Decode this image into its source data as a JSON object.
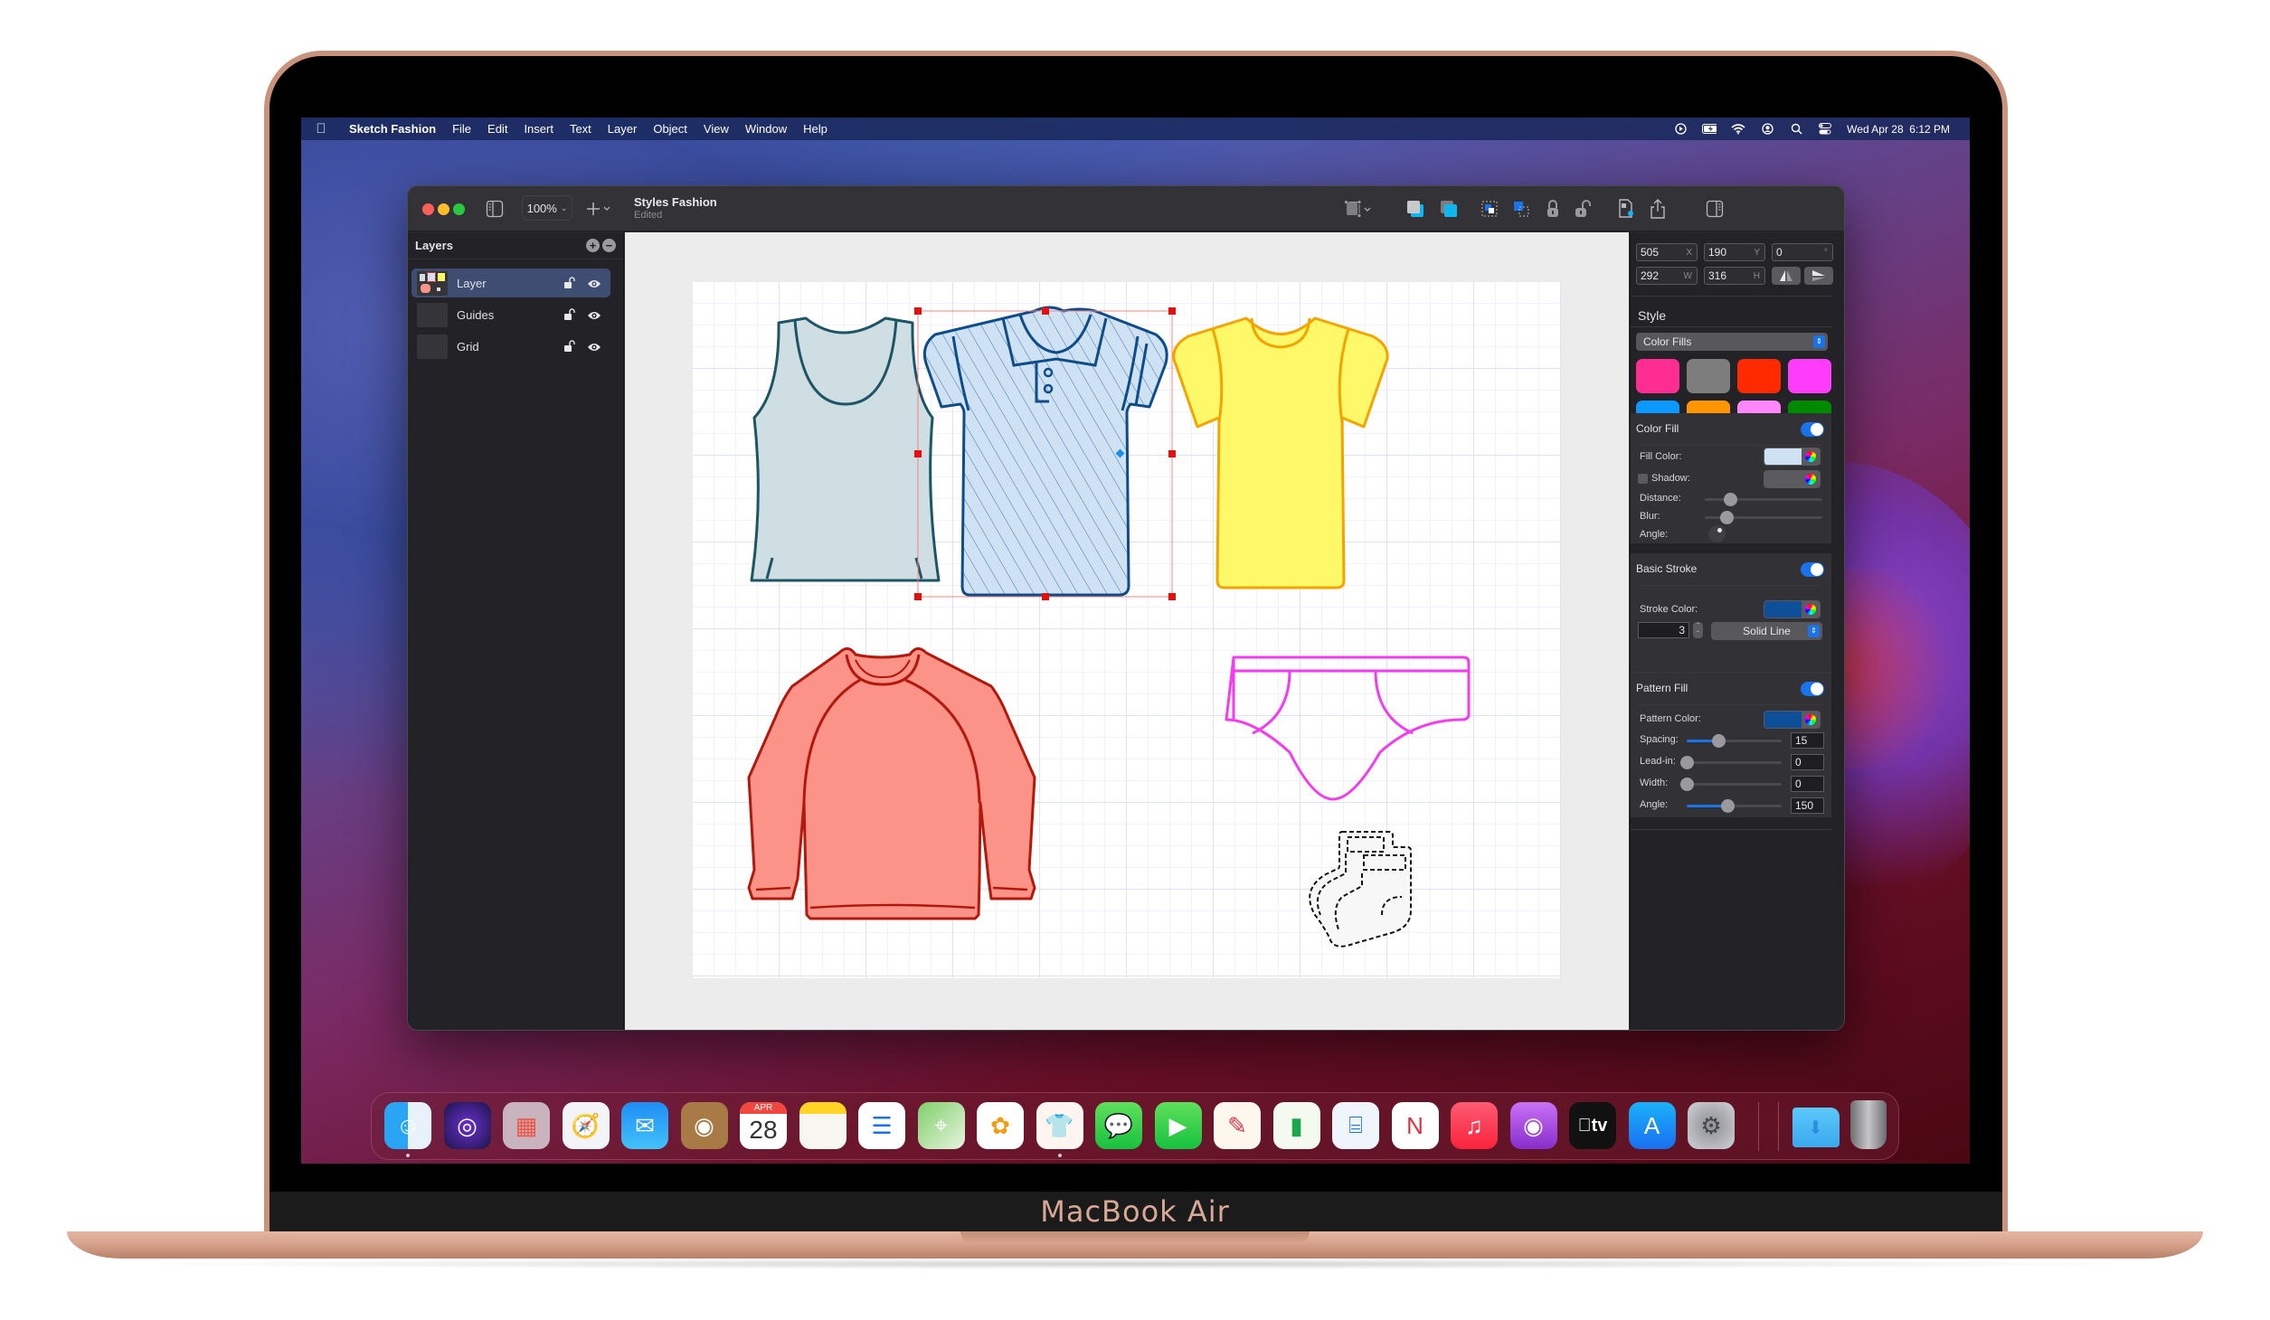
{
  "device": {
    "brand_label": "MacBook Air"
  },
  "menubar": {
    "app_name": "Sketch Fashion",
    "items": [
      "File",
      "Edit",
      "Insert",
      "Text",
      "Layer",
      "Object",
      "View",
      "Window",
      "Help"
    ],
    "status_icons": [
      "play-circle-icon",
      "battery-charging-icon",
      "wifi-icon",
      "user-icon",
      "search-icon",
      "control-center-icon"
    ],
    "clock": "Wed Apr 28  6:12 PM"
  },
  "window": {
    "zoom_level": "100%",
    "document_title": "Styles Fashion",
    "document_status": "Edited",
    "toolbar_icons": [
      "sidebar-toggle-icon",
      "insert-plus-icon",
      "artboard-icon",
      "bring-forward-icon",
      "send-backward-icon",
      "group-icon",
      "ungroup-icon",
      "lock-icon",
      "unlock-icon",
      "document-settings-icon",
      "share-icon",
      "inspector-toggle-icon"
    ]
  },
  "layers": {
    "title": "Layers",
    "add_label": "+",
    "remove_label": "−",
    "items": [
      {
        "name": "Layer",
        "selected": true,
        "locked": false,
        "visible": true
      },
      {
        "name": "Guides",
        "selected": false,
        "locked": false,
        "visible": true
      },
      {
        "name": "Grid",
        "selected": false,
        "locked": false,
        "visible": true
      }
    ]
  },
  "canvas": {
    "garments": [
      {
        "name": "tank-top",
        "fill": "#cfdee3",
        "stroke": "#1d5566"
      },
      {
        "name": "polo-shirt",
        "fill": "#cfe2f3",
        "stroke": "#0f4c8a",
        "pattern": "diagonal-lines",
        "selected": true
      },
      {
        "name": "t-shirt",
        "fill": "#fff96a",
        "stroke": "#f5a300"
      },
      {
        "name": "sweatshirt",
        "fill": "#fc9388",
        "stroke": "#b3180c"
      },
      {
        "name": "briefs",
        "fill": "none",
        "stroke": "#f33cf0"
      },
      {
        "name": "socks",
        "fill": "#f7f7f7",
        "stroke": "#111111",
        "dashed": true
      }
    ]
  },
  "inspector": {
    "position": {
      "x": {
        "value": "505",
        "unit": "X"
      },
      "y": {
        "value": "190",
        "unit": "Y"
      },
      "rotation": {
        "value": "0",
        "unit": "°"
      },
      "w": {
        "value": "292",
        "unit": "W"
      },
      "h": {
        "value": "316",
        "unit": "H"
      }
    },
    "style": {
      "title": "Style",
      "preset_select": "Color Fills",
      "swatches": [
        "#ff2d91",
        "#7d7d7d",
        "#ff2a00",
        "#ff3cfc",
        "#0a99ff",
        "#ff9500",
        "#ff86fb",
        "#008a00"
      ]
    },
    "color_fill": {
      "title": "Color Fill",
      "enabled": true,
      "fill_color_label": "Fill Color:",
      "fill_color": "#cfe2f3",
      "shadow_label": "Shadow:",
      "shadow_enabled": false,
      "shadow_color": "#5b5a5f",
      "distance_label": "Distance:",
      "distance": 0.2,
      "blur_label": "Blur:",
      "blur": 0.15,
      "angle_label": "Angle:"
    },
    "basic_stroke": {
      "title": "Basic Stroke",
      "enabled": true,
      "stroke_color_label": "Stroke Color:",
      "stroke_color": "#0d4f99",
      "width": "3",
      "style_select": "Solid Line"
    },
    "pattern_fill": {
      "title": "Pattern Fill",
      "enabled": true,
      "pattern_color_label": "Pattern Color:",
      "pattern_color": "#0d4f99",
      "rows": [
        {
          "label": "Spacing:",
          "value": "15",
          "fraction": 0.33
        },
        {
          "label": "Lead-in:",
          "value": "0",
          "fraction": 0.0
        },
        {
          "label": "Width:",
          "value": "0",
          "fraction": 0.0
        },
        {
          "label": "Angle:",
          "value": "150",
          "fraction": 0.43
        }
      ]
    }
  },
  "dock": {
    "apps": [
      {
        "name": "Finder",
        "icon": "finder-icon",
        "running": true
      },
      {
        "name": "Siri",
        "icon": "siri-icon",
        "running": false
      },
      {
        "name": "Launchpad",
        "icon": "launchpad-icon",
        "running": false
      },
      {
        "name": "Safari",
        "icon": "safari-icon",
        "running": false
      },
      {
        "name": "Mail",
        "icon": "mail-icon",
        "running": false
      },
      {
        "name": "Contacts",
        "icon": "contacts-icon",
        "running": false
      },
      {
        "name": "Calendar",
        "icon": "calendar-icon",
        "running": false,
        "month": "APR",
        "day": "28"
      },
      {
        "name": "Notes",
        "icon": "notes-icon",
        "running": false
      },
      {
        "name": "Reminders",
        "icon": "reminders-icon",
        "running": false
      },
      {
        "name": "Maps",
        "icon": "maps-icon",
        "running": false
      },
      {
        "name": "Photos",
        "icon": "photos-icon",
        "running": false
      },
      {
        "name": "Sketch Fashion",
        "icon": "sketch-fashion-icon",
        "running": true
      },
      {
        "name": "Messages",
        "icon": "messages-icon",
        "running": false
      },
      {
        "name": "FaceTime",
        "icon": "facetime-icon",
        "running": false
      },
      {
        "name": "Pages",
        "icon": "pages-icon",
        "running": false
      },
      {
        "name": "Numbers",
        "icon": "numbers-icon",
        "running": false
      },
      {
        "name": "Keynote",
        "icon": "keynote-icon",
        "running": false
      },
      {
        "name": "News",
        "icon": "news-icon",
        "running": false
      },
      {
        "name": "Music",
        "icon": "music-icon",
        "running": false
      },
      {
        "name": "Podcasts",
        "icon": "podcasts-icon",
        "running": false
      },
      {
        "name": "TV",
        "icon": "tv-icon",
        "running": false,
        "label": "tv"
      },
      {
        "name": "App Store",
        "icon": "app-store-icon",
        "running": false
      },
      {
        "name": "System Preferences",
        "icon": "system-preferences-icon",
        "running": false
      }
    ],
    "stack": [
      {
        "name": "Downloads",
        "icon": "downloads-folder-icon"
      },
      {
        "name": "Trash",
        "icon": "trash-icon"
      }
    ]
  }
}
